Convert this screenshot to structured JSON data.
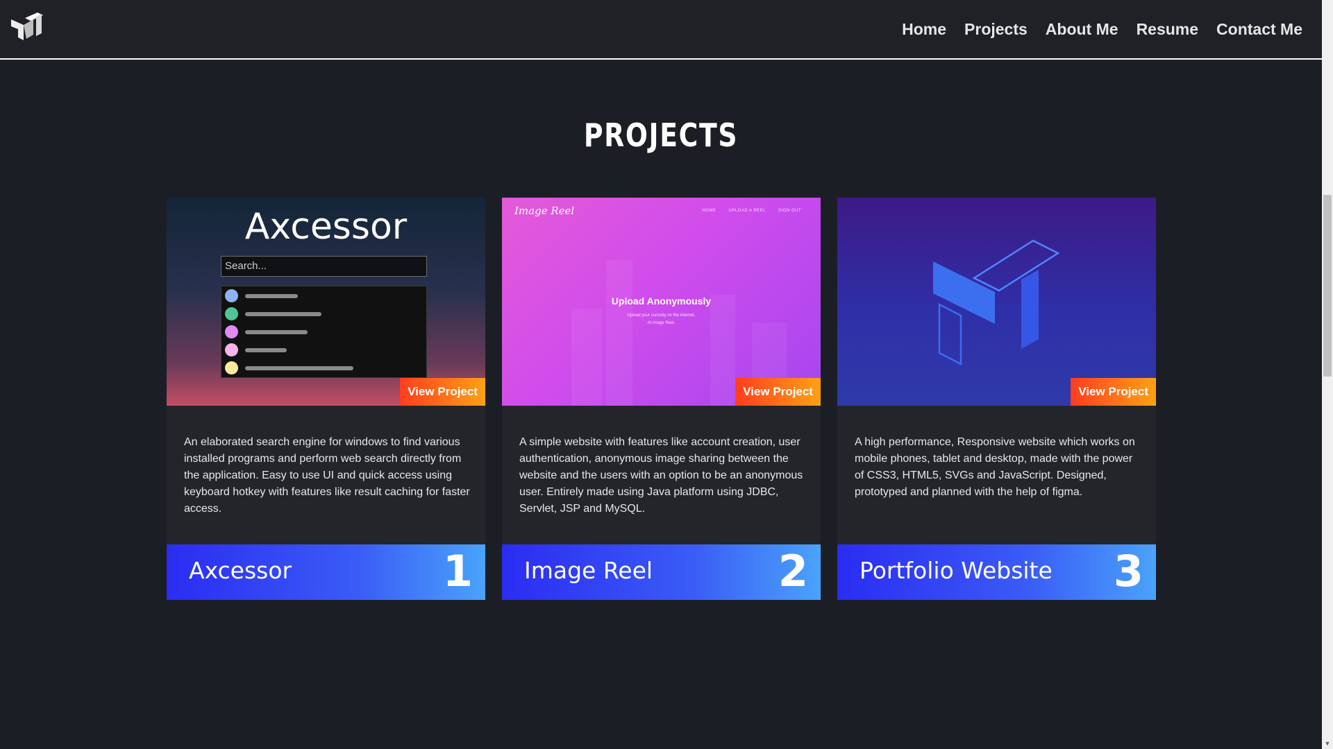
{
  "nav": {
    "links": [
      "Home",
      "Projects",
      "About Me",
      "Resume",
      "Contact Me"
    ]
  },
  "section": {
    "title": "PROJECTS"
  },
  "projects": [
    {
      "number": "1",
      "title": "Axcessor",
      "view_label": "View Project",
      "description": "An elaborated search engine for windows to find various installed programs and perform web search directly from the application. Easy to use UI and quick access using keyboard hotkey with features like result caching for faster access.",
      "thumbnail": {
        "heading": "Axcessor",
        "search_placeholder": "Search..."
      }
    },
    {
      "number": "2",
      "title": "Image Reel",
      "view_label": "View Project",
      "description": "A simple website with features like account creation, user authentication, anonymous image sharing between the website and the users with an option to be an anonymous user. Entirely made using Java platform using JDBC, Servlet, JSP and MySQL.",
      "thumbnail": {
        "brand": "Image Reel",
        "nav": [
          "HOME",
          "UPLOAD A REEL",
          "SIGN OUT"
        ],
        "heading": "Upload Anonymously",
        "subtext_line1": "Upload your curiosity on the internet.",
        "subtext_line2": "At Image Reel."
      }
    },
    {
      "number": "3",
      "title": "Portfolio Website",
      "view_label": "View Project",
      "description": "A high performance, Responsive website which works on mobile phones, tablet and desktop, made with the power of CSS3, HTML5, SVGs and JavaScript. Designed, prototyped and planned with the help of figma."
    }
  ],
  "colors": {
    "background": "#1c1e26",
    "card": "#23252b",
    "accent_orange": "#ff5a1f",
    "accent_blue": "#2b2cf2"
  }
}
